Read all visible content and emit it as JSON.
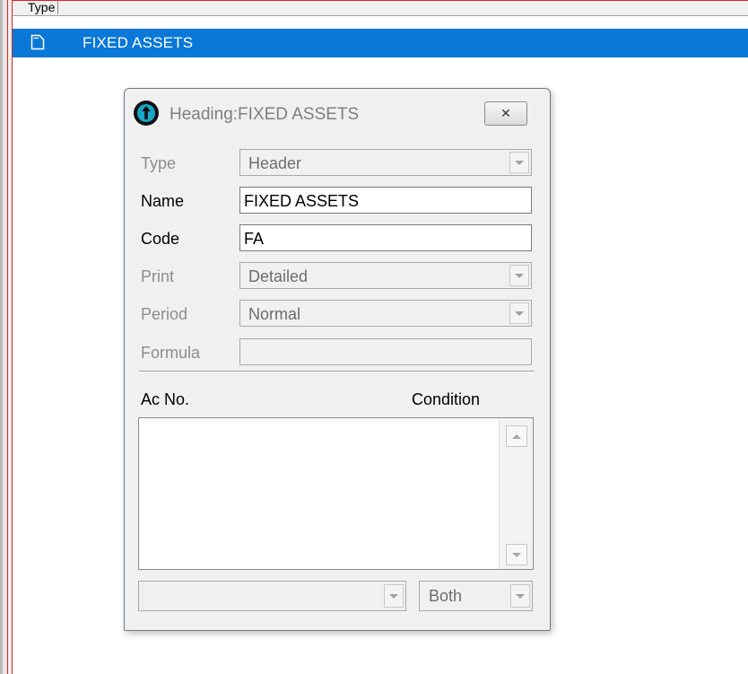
{
  "grid": {
    "column_header": "Type",
    "selected_row": {
      "text": "FIXED ASSETS",
      "icon": "document-icon"
    }
  },
  "dialog": {
    "title": "Heading:FIXED ASSETS",
    "title_icon": "info-circle-icon",
    "close_label": "✕",
    "fields": {
      "type": {
        "label": "Type",
        "value": "Header"
      },
      "name": {
        "label": "Name",
        "value": "FIXED ASSETS"
      },
      "code": {
        "label": "Code",
        "value": "FA"
      },
      "print": {
        "label": "Print",
        "value": "Detailed"
      },
      "period": {
        "label": "Period",
        "value": "Normal"
      },
      "formula": {
        "label": "Formula",
        "value": ""
      }
    },
    "list": {
      "col_account": "Ac No.",
      "col_condition": "Condition",
      "items": []
    },
    "bottom": {
      "account_value": "",
      "condition_value": "Both"
    }
  },
  "colors": {
    "selection": "#0a78d7",
    "frame_border": "#e02020",
    "dialog_bg": "#f0f0f0"
  }
}
